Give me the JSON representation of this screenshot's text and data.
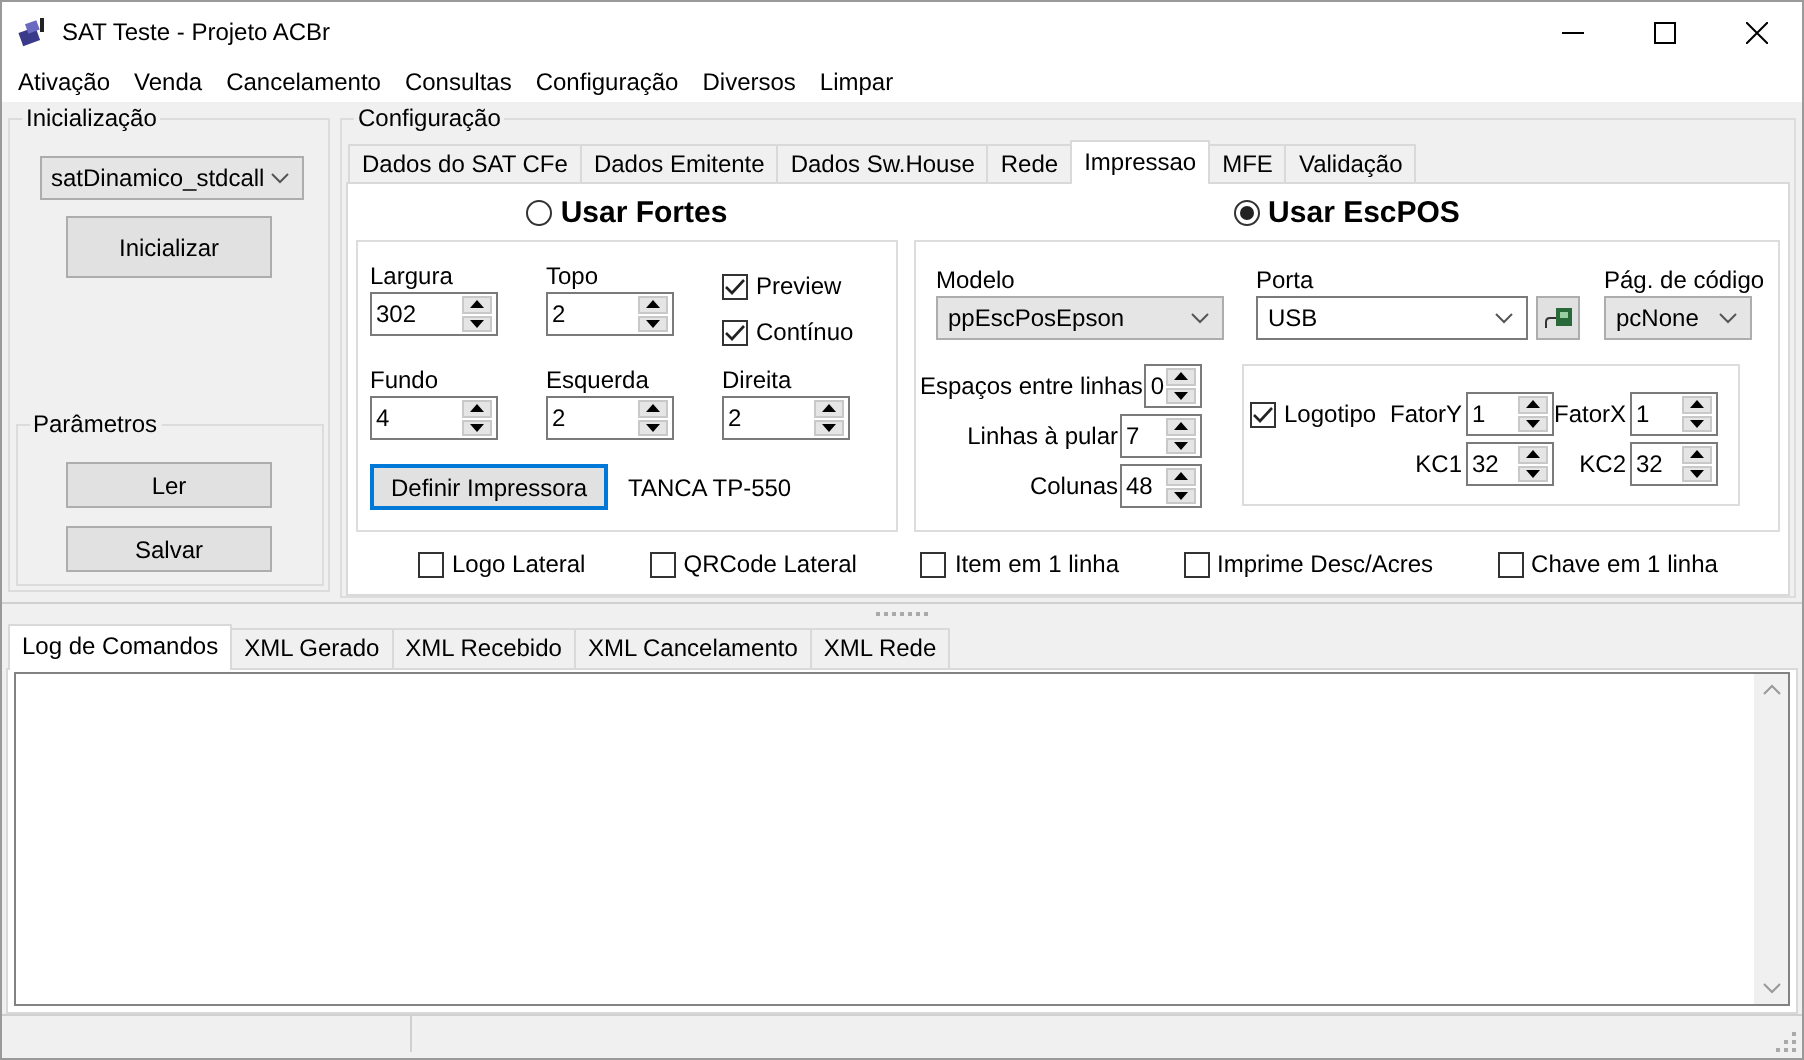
{
  "window": {
    "title": "SAT Teste - Projeto ACBr"
  },
  "menu": [
    "Ativação",
    "Venda",
    "Cancelamento",
    "Consultas",
    "Configuração",
    "Diversos",
    "Limpar"
  ],
  "inicializacao": {
    "title": "Inicialização",
    "library": "satDinamico_stdcall",
    "button": "Inicializar"
  },
  "parametros": {
    "title": "Parâmetros",
    "buttons": [
      "Ler",
      "Salvar"
    ]
  },
  "configuracao": {
    "title": "Configuração",
    "tabs": [
      {
        "label": "Dados do SAT CFe",
        "selected": false
      },
      {
        "label": "Dados Emitente",
        "selected": false
      },
      {
        "label": "Dados Sw.House",
        "selected": false
      },
      {
        "label": "Rede",
        "selected": false
      },
      {
        "label": "Impressao",
        "selected": true
      },
      {
        "label": "MFE",
        "selected": false
      },
      {
        "label": "Validação",
        "selected": false
      }
    ]
  },
  "fortes": {
    "label": "Usar Fortes",
    "selected": false,
    "fields": [
      {
        "label": "Largura",
        "value": "302"
      },
      {
        "label": "Topo",
        "value": "2"
      },
      {
        "label": "Fundo",
        "value": "4"
      },
      {
        "label": "Esquerda",
        "value": "2"
      },
      {
        "label": "Direita",
        "value": "2"
      }
    ],
    "checkboxes": [
      {
        "label": "Preview",
        "checked": true
      },
      {
        "label": "Contínuo",
        "checked": true
      }
    ],
    "button": "Definir Impressora",
    "printer": "TANCA TP-550"
  },
  "escpos": {
    "label": "Usar EscPOS",
    "selected": true,
    "modelo": {
      "label": "Modelo",
      "value": "ppEscPosEpson"
    },
    "porta": {
      "label": "Porta",
      "value": "USB"
    },
    "pagina": {
      "label": "Pág. de código",
      "value": "pcNone"
    },
    "spins": [
      {
        "label": "Espaços entre linhas",
        "value": "0"
      },
      {
        "label": "Linhas à pular",
        "value": "7"
      },
      {
        "label": "Colunas",
        "value": "48"
      }
    ],
    "logotipo": {
      "label": "Logotipo",
      "checked": true,
      "fields": [
        {
          "label": "FatorY",
          "value": "1"
        },
        {
          "label": "FatorX",
          "value": "1"
        },
        {
          "label": "KC1",
          "value": "32"
        },
        {
          "label": "KC2",
          "value": "32"
        }
      ]
    }
  },
  "options": [
    {
      "label": "Logo Lateral",
      "checked": false
    },
    {
      "label": "QRCode Lateral",
      "checked": false
    },
    {
      "label": "Item em 1 linha",
      "checked": false
    },
    {
      "label": "Imprime Desc/Acres",
      "checked": false
    },
    {
      "label": "Chave em 1 linha",
      "checked": false
    }
  ],
  "log_tabs": [
    {
      "label": "Log de Comandos",
      "selected": true
    },
    {
      "label": "XML Gerado",
      "selected": false
    },
    {
      "label": "XML Recebido",
      "selected": false
    },
    {
      "label": "XML Cancelamento",
      "selected": false
    },
    {
      "label": "XML Rede",
      "selected": false
    }
  ]
}
